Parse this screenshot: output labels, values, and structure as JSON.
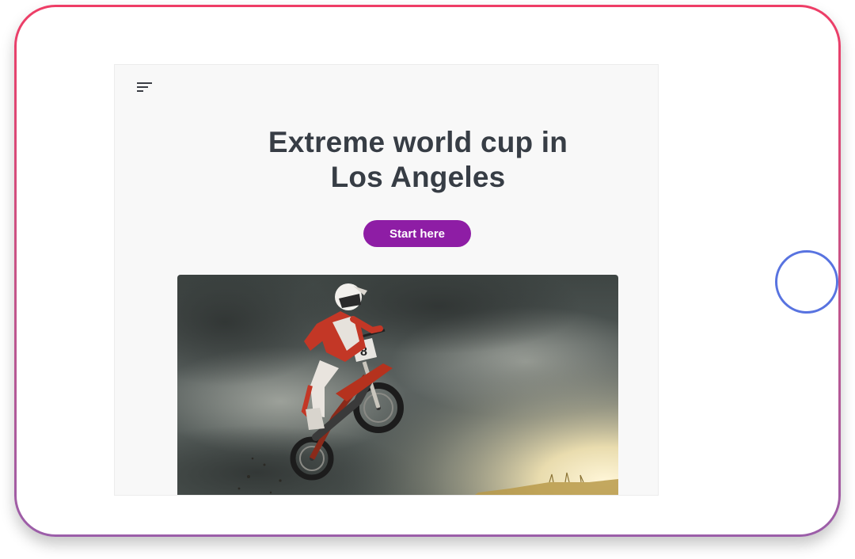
{
  "page": {
    "title_lines": [
      "Extreme world cup in",
      "Los Angeles"
    ],
    "cta_label": "Start here"
  },
  "icons": {
    "menu": "menu-icon",
    "home": "home-button"
  },
  "colors": {
    "frame_gradient_top": "#ee3d66",
    "frame_gradient_bottom": "#9b5ea9",
    "cta_background": "#8e1da5",
    "title_text": "#373d45",
    "home_button_ring": "#5873e0"
  },
  "hero_image": {
    "subject": "motocross rider jumping against stormy sky",
    "bib_number": "8"
  }
}
